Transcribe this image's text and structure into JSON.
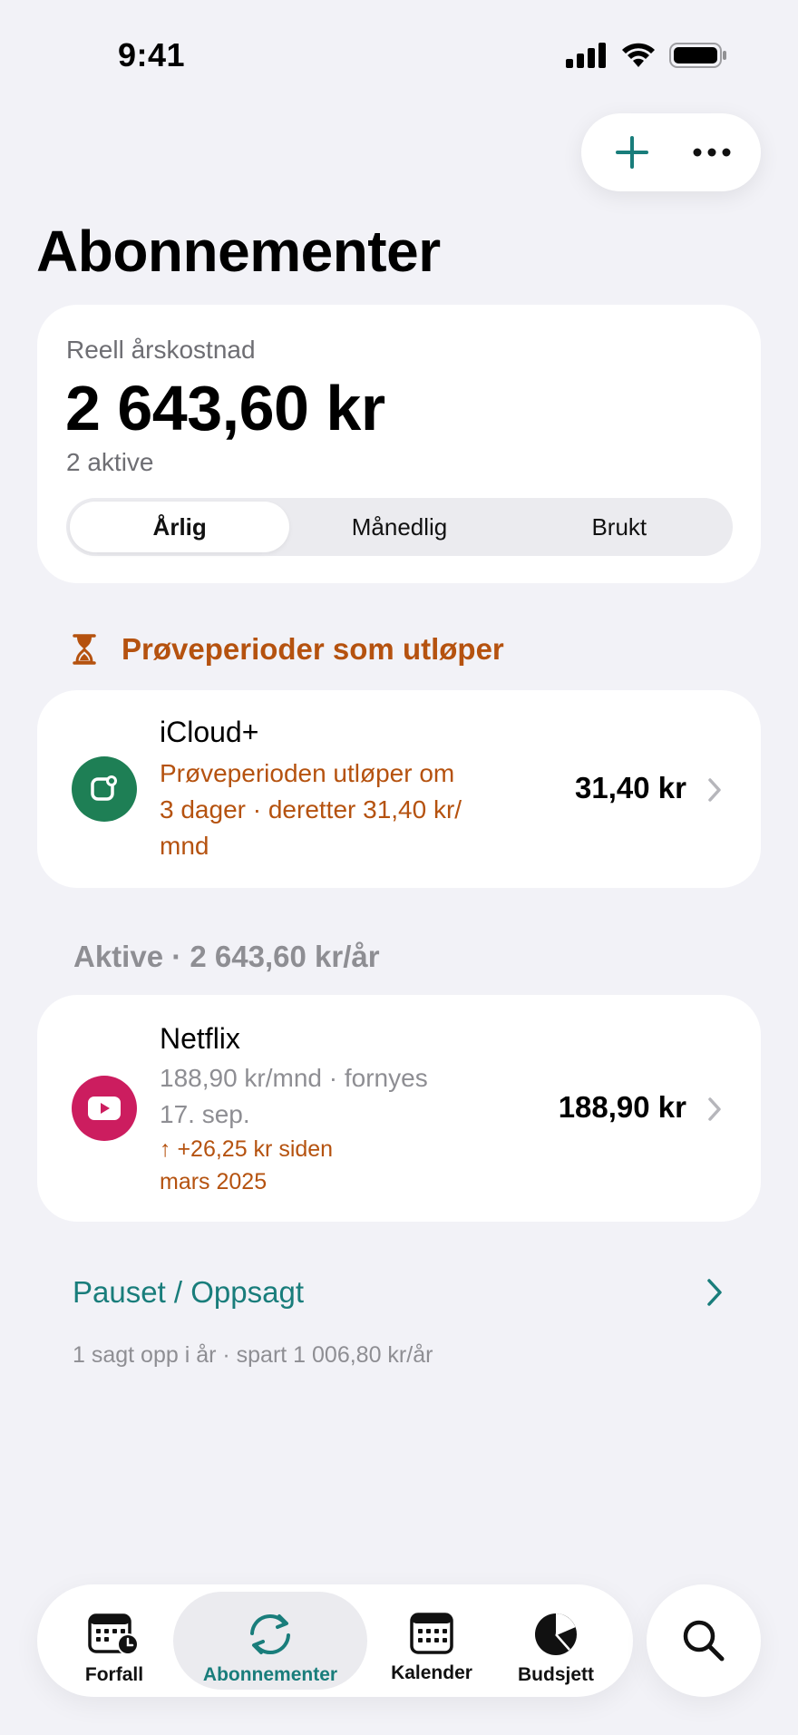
{
  "status_bar": {
    "time": "9:41"
  },
  "toolbar": {
    "add_icon": "plus-icon",
    "more_icon": "ellipsis-icon"
  },
  "page": {
    "title": "Abonnementer"
  },
  "summary": {
    "label": "Reell årskostnad",
    "amount": "2 643,60 kr",
    "sub": "2 aktive",
    "segments": [
      "Årlig",
      "Månedlig",
      "Brukt"
    ],
    "selected_segment": "Årlig"
  },
  "trial_section": {
    "title": "Prøveperioder som utløper",
    "icon": "hourglass-icon",
    "items": [
      {
        "name": "iCloud+",
        "detail_lines": [
          "Prøveperioden utløper om",
          "3 dager · deretter 31,40 kr/",
          "mnd"
        ],
        "amount": "31,40 kr",
        "icon": "icloud-icon",
        "icon_color": "#1e7f55"
      }
    ]
  },
  "active_section": {
    "title": "Aktive · 2 643,60 kr/år",
    "items": [
      {
        "name": "Netflix",
        "detail_lines": [
          "188,90 kr/mnd · fornyes",
          "17. sep."
        ],
        "change_lines": [
          "↑ +26,25 kr siden",
          "mars 2025"
        ],
        "amount": "188,90 kr",
        "icon": "play-icon",
        "icon_color": "#cc1d5f"
      }
    ]
  },
  "paused": {
    "label": "Pauset / Oppsagt",
    "note": "1 sagt opp i år · spart 1 006,80 kr/år"
  },
  "tab_bar": {
    "tabs": [
      {
        "label": "Forfall",
        "icon": "calendar-clock-icon"
      },
      {
        "label": "Abonnementer",
        "icon": "refresh-icon",
        "active": true
      },
      {
        "label": "Kalender",
        "icon": "calendar-icon"
      },
      {
        "label": "Budsjett",
        "icon": "pie-chart-icon"
      }
    ],
    "search_icon": "search-icon"
  },
  "colors": {
    "accent": "#197d7b",
    "warning": "#b5520f",
    "background": "#f2f2f7",
    "secondary_text": "#8e8e93"
  }
}
